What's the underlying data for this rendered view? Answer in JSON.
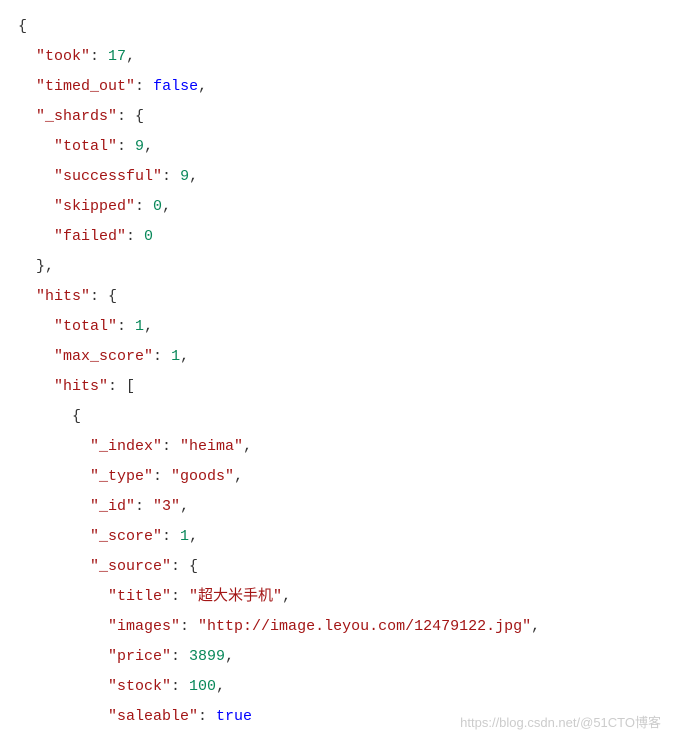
{
  "json": {
    "took": {
      "key": "\"took\"",
      "value": "17"
    },
    "timed_out": {
      "key": "\"timed_out\"",
      "value": "false"
    },
    "shards": {
      "key": "\"_shards\"",
      "total": {
        "key": "\"total\"",
        "value": "9"
      },
      "successful": {
        "key": "\"successful\"",
        "value": "9"
      },
      "skipped": {
        "key": "\"skipped\"",
        "value": "0"
      },
      "failed": {
        "key": "\"failed\"",
        "value": "0"
      }
    },
    "hits": {
      "key": "\"hits\"",
      "total": {
        "key": "\"total\"",
        "value": "1"
      },
      "max_score": {
        "key": "\"max_score\"",
        "value": "1"
      },
      "hits_arr": {
        "key": "\"hits\"",
        "item": {
          "index": {
            "key": "\"_index\"",
            "value": "\"heima\""
          },
          "type": {
            "key": "\"_type\"",
            "value": "\"goods\""
          },
          "id": {
            "key": "\"_id\"",
            "value": "\"3\""
          },
          "score": {
            "key": "\"_score\"",
            "value": "1"
          },
          "source": {
            "key": "\"_source\"",
            "title": {
              "key": "\"title\"",
              "value": "\"超大米手机\""
            },
            "images": {
              "key": "\"images\"",
              "value": "\"http://image.leyou.com/12479122.jpg\""
            },
            "price": {
              "key": "\"price\"",
              "value": "3899"
            },
            "stock": {
              "key": "\"stock\"",
              "value": "100"
            },
            "saleable": {
              "key": "\"saleable\"",
              "value": "true"
            }
          }
        }
      }
    }
  },
  "watermark": {
    "left": "https://blog.csdn.net/",
    "right": "@51CTO博客"
  }
}
